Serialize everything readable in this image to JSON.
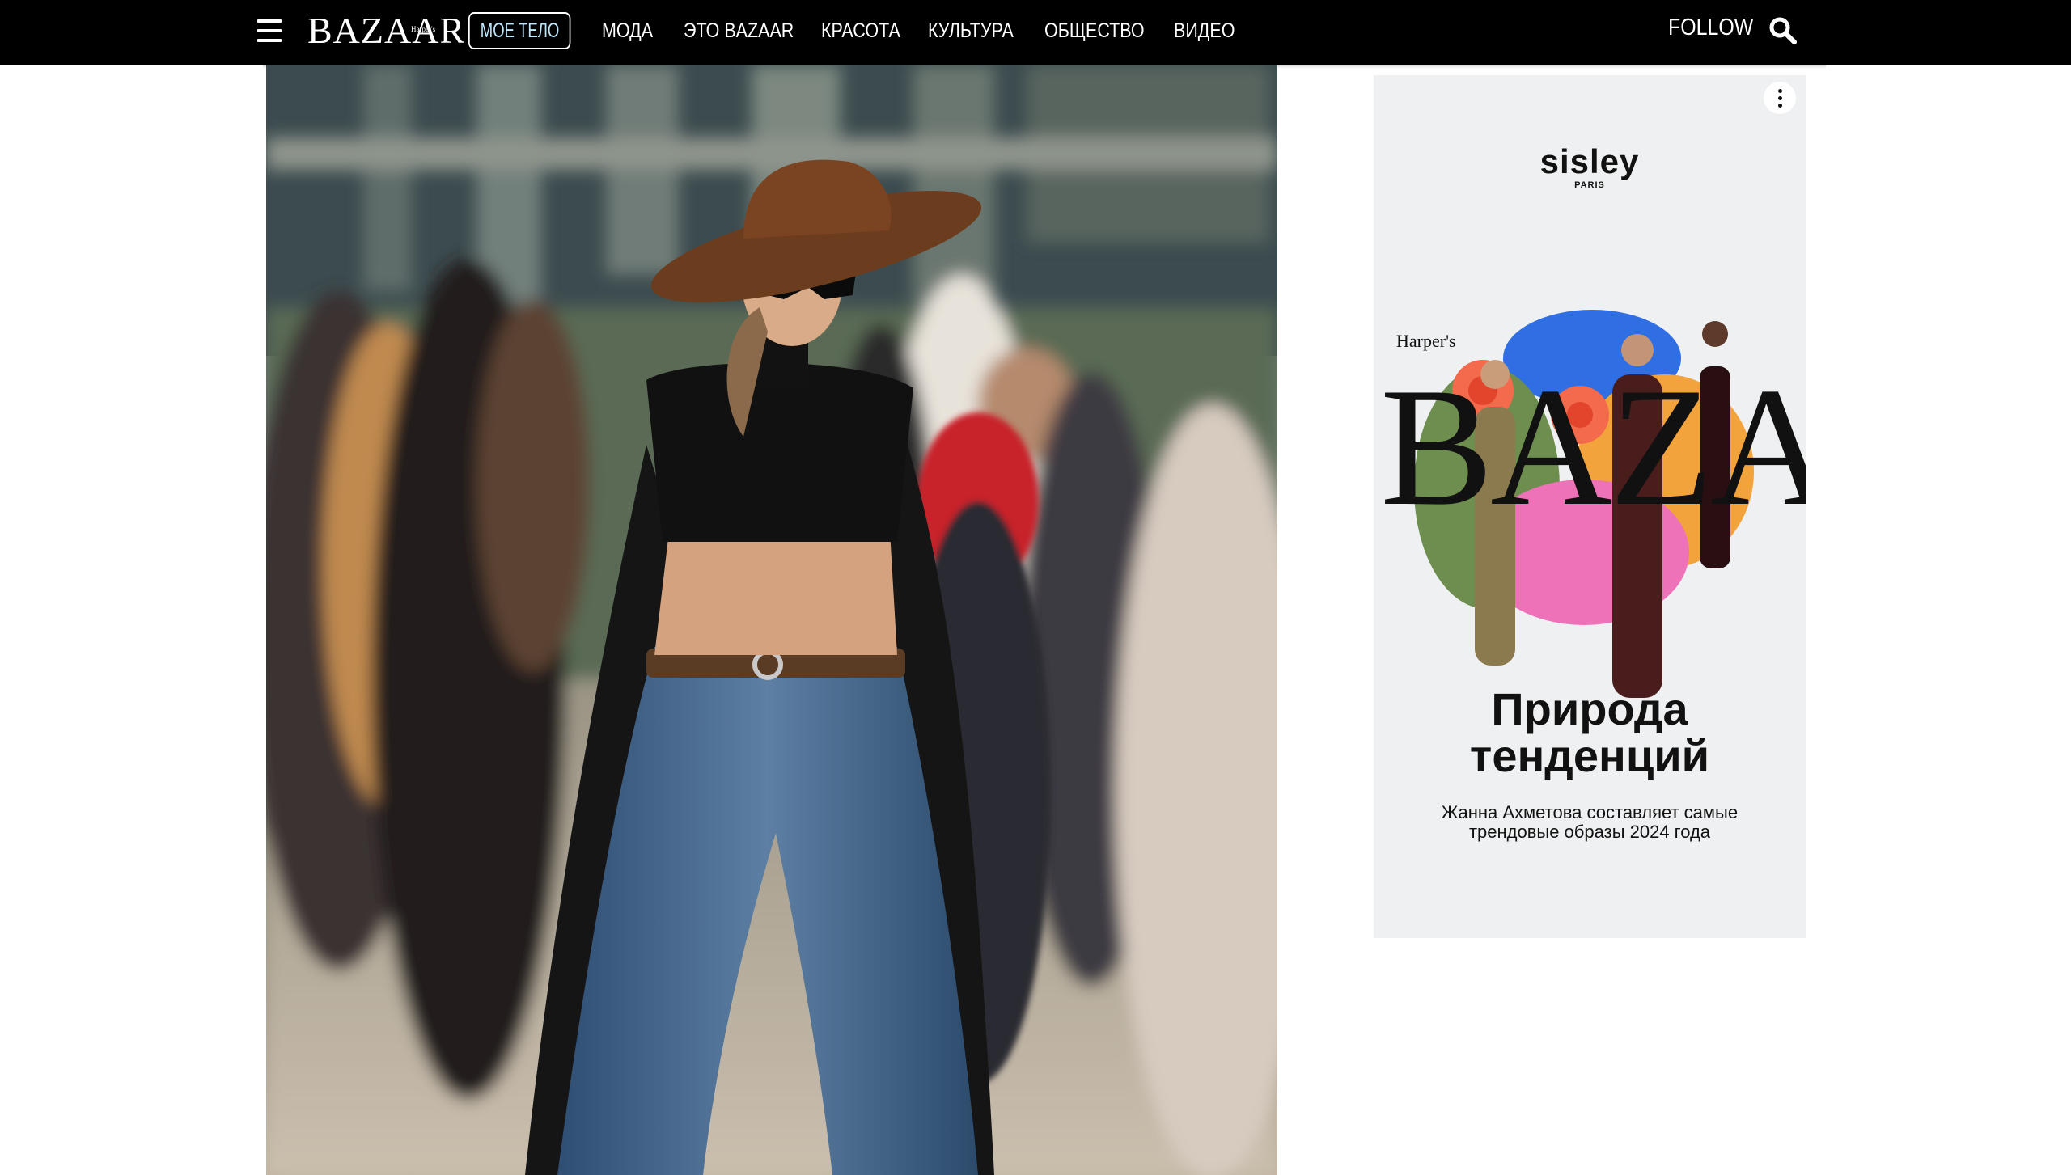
{
  "header": {
    "logo": "BAZAAR",
    "logo_small": "Harper's",
    "logo_sub": "KAZAKHSTAN",
    "nav": [
      "МОЕ ТЕЛО",
      "МОДА",
      "ЭТО BAZAAR",
      "КРАСОТА",
      "КУЛЬТУРА",
      "ОБЩЕСТВО",
      "ВИДЕО"
    ],
    "follow": "FOLLOW"
  },
  "article": {
    "photo_icon": "street-style-photo"
  },
  "ad": {
    "brand": "sisley",
    "brand_sub": "PARIS",
    "magazine_small": "Harper's",
    "magazine_big": "BAZAAR",
    "headline_1": "Природа",
    "headline_2": "тенденций",
    "subline": "Жанна Ахметова составляет самые трендовые образы 2024 года"
  },
  "colors": {
    "header_bg": "#000000",
    "active_nav_text": "#bfe8ff",
    "ad_bg": "#eef0f1"
  }
}
